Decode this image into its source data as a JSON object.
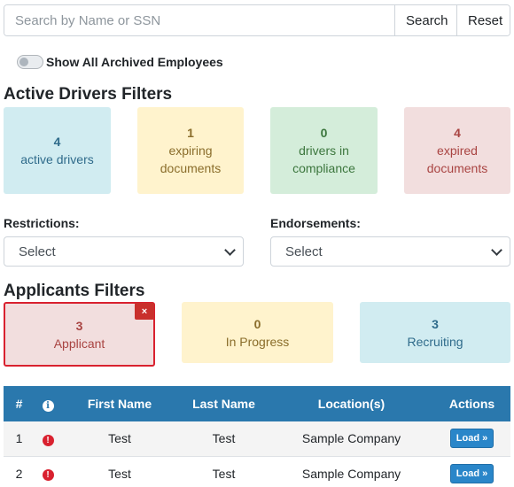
{
  "search": {
    "placeholder": "Search by Name or SSN",
    "search_label": "Search",
    "reset_label": "Reset"
  },
  "archived_toggle": {
    "label": "Show All Archived Employees",
    "checked": false
  },
  "active_filters": {
    "heading": "Active Drivers Filters",
    "cards": [
      {
        "count": "4",
        "label": "active drivers",
        "color": "#d1ecf1"
      },
      {
        "count": "1",
        "label": "expiring documents",
        "color": "#fff3cd"
      },
      {
        "count": "0",
        "label": "drivers in compliance",
        "color": "#d4edda"
      },
      {
        "count": "4",
        "label": "expired documents",
        "color": "#f2dede"
      }
    ]
  },
  "restrictions": {
    "label": "Restrictions:",
    "value": "Select"
  },
  "endorsements": {
    "label": "Endorsements:",
    "value": "Select"
  },
  "applicant_filters": {
    "heading": "Applicants Filters",
    "close_glyph": "×",
    "cards": [
      {
        "count": "3",
        "label": "Applicant",
        "color": "#f2dede",
        "selected": true
      },
      {
        "count": "0",
        "label": "In Progress",
        "color": "#fff3cd",
        "selected": false
      },
      {
        "count": "3",
        "label": "Recruiting",
        "color": "#d1ecf1",
        "selected": false
      }
    ]
  },
  "table": {
    "header_color": "#2a78ad",
    "columns": [
      "#",
      "",
      "First Name",
      "Last Name",
      "Location(s)",
      "Actions"
    ],
    "info_glyph": "i",
    "error_glyph": "!",
    "rows": [
      {
        "num": "1",
        "first": "Test",
        "last": "Test",
        "location": "Sample Company",
        "action": "Load »"
      },
      {
        "num": "2",
        "first": "Test",
        "last": "Test",
        "location": "Sample Company",
        "action": "Load »"
      }
    ]
  }
}
